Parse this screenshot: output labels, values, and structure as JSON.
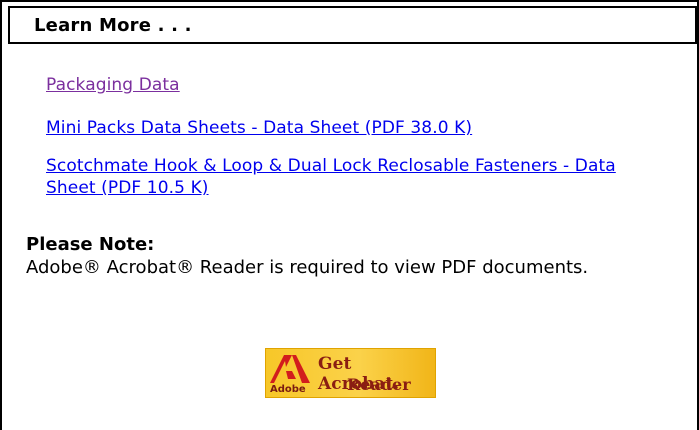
{
  "header": {
    "title": "Learn More . . ."
  },
  "links": [
    {
      "label": "Packaging Data",
      "state": "visited"
    },
    {
      "label": "Mini Packs Data Sheets - Data Sheet (PDF 38.0 K)",
      "state": "unvisited"
    },
    {
      "label": "Scotchmate Hook & Loop & Dual Lock Reclosable Fasteners - Data Sheet (PDF 10.5 K)",
      "state": "unvisited"
    }
  ],
  "note": {
    "title": "Please Note:",
    "body": "Adobe® Acrobat® Reader is required to view PDF documents."
  },
  "acrobat_badge": {
    "line1": "Get Acrobat.",
    "line2": "Reader",
    "brand": "Adobe",
    "icon": "adobe-logo-icon"
  },
  "colors": {
    "visited_link": "#7b2f9e",
    "link": "#0000ee",
    "badge_yellow": "#f7c728",
    "badge_text": "#8a1e12",
    "adobe_red": "#d21d1d"
  }
}
